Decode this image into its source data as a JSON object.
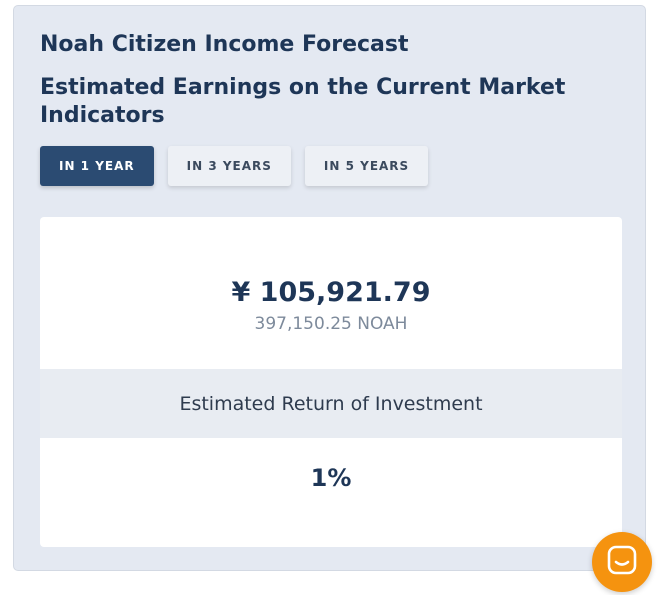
{
  "forecast": {
    "title": "Noah Citizen Income Forecast",
    "subtitle": "Estimated Earnings on the Current Market Indicators",
    "tabs": [
      {
        "label": "IN 1 YEAR",
        "active": true
      },
      {
        "label": "IN 3 YEARS",
        "active": false
      },
      {
        "label": "IN 5 YEARS",
        "active": false
      }
    ],
    "result": {
      "amount": "¥ 105,921.79",
      "token_amount": "397,150.25 NOAH",
      "roi_label": "Estimated Return of Investment",
      "roi_value": "1%"
    }
  },
  "chat": {
    "icon": "chat-bubble-icon",
    "color": "#f5930f"
  },
  "colors": {
    "panel_bg": "#e4e9f2",
    "heading": "#1e3657",
    "active_tab": "#2b4b72",
    "inactive_tab": "#edf0f5"
  }
}
